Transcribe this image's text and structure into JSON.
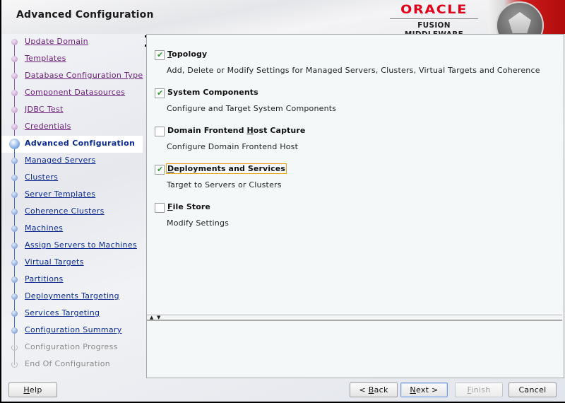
{
  "header": {
    "title": "Advanced Configuration",
    "brand_name": "ORACLE",
    "brand_product": "FUSION MIDDLEWARE"
  },
  "nav": {
    "items": [
      {
        "label": "Update Domain",
        "state": "visited"
      },
      {
        "label": "Templates",
        "state": "visited"
      },
      {
        "label": "Database Configuration Type",
        "state": "visited"
      },
      {
        "label": "Component Datasources",
        "state": "visited"
      },
      {
        "label": "JDBC Test",
        "state": "visited"
      },
      {
        "label": "Credentials",
        "state": "visited"
      },
      {
        "label": "Advanced Configuration",
        "state": "current"
      },
      {
        "label": "Managed Servers",
        "state": "pending"
      },
      {
        "label": "Clusters",
        "state": "pending"
      },
      {
        "label": "Server Templates",
        "state": "pending"
      },
      {
        "label": "Coherence Clusters",
        "state": "pending"
      },
      {
        "label": "Machines",
        "state": "pending"
      },
      {
        "label": "Assign Servers to Machines",
        "state": "pending"
      },
      {
        "label": "Virtual Targets",
        "state": "pending"
      },
      {
        "label": "Partitions",
        "state": "pending"
      },
      {
        "label": "Deployments Targeting",
        "state": "pending"
      },
      {
        "label": "Services Targeting",
        "state": "pending"
      },
      {
        "label": "Configuration Summary",
        "state": "pending"
      },
      {
        "label": "Configuration Progress",
        "state": "disabled"
      },
      {
        "label": "End Of Configuration",
        "state": "disabled"
      }
    ]
  },
  "options": [
    {
      "label": "Topology",
      "mnemonic": "T",
      "checked": true,
      "description": "Add, Delete or Modify Settings for Managed Servers, Clusters, Virtual Targets and Coherence"
    },
    {
      "label": "System Components",
      "mnemonic": "",
      "checked": true,
      "description": "Configure and Target System Components"
    },
    {
      "label": "Domain Frontend Host Capture",
      "mnemonic": "H",
      "checked": false,
      "description": "Configure Domain Frontend Host"
    },
    {
      "label": "Deployments and Services",
      "mnemonic": "D",
      "checked": true,
      "focused": true,
      "description": "Target to Servers or Clusters"
    },
    {
      "label": "File Store",
      "mnemonic": "F",
      "checked": false,
      "description": "Modify Settings"
    }
  ],
  "icons": {
    "check": "✔",
    "split_up": "▲",
    "split_down": "▼"
  },
  "buttons": {
    "help": {
      "label": "Help",
      "mnemonic": "H"
    },
    "back": {
      "label": "< Back",
      "mnemonic": "B"
    },
    "next": {
      "label": "Next >",
      "mnemonic": "N"
    },
    "finish": {
      "label": "Finish",
      "mnemonic": "F",
      "disabled": true
    },
    "cancel": {
      "label": "Cancel",
      "mnemonic": ""
    }
  },
  "colors": {
    "brand_red": "#e0001b",
    "visited_link": "#6a1b7a",
    "pending_link": "#0b2a8f",
    "check_green": "#2e9e2e",
    "focus_outline": "#f0a020"
  }
}
